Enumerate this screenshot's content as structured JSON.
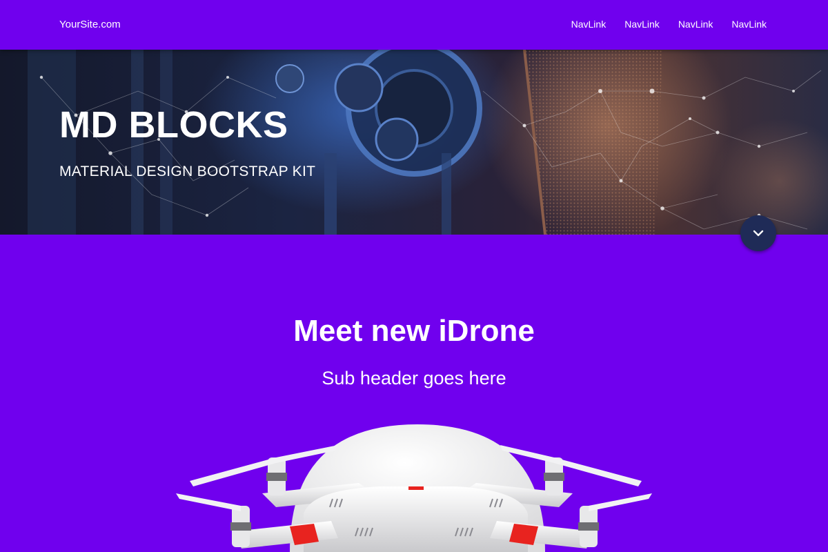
{
  "nav": {
    "brand": "YourSite.com",
    "links": [
      "NavLink",
      "NavLink",
      "NavLink",
      "NavLink"
    ]
  },
  "hero": {
    "title": "MD BLOCKS",
    "subtitle": "MATERIAL DESIGN BOOTSTRAP KIT",
    "scroll_icon": "chevron-down-icon"
  },
  "product": {
    "title": "Meet new iDrone",
    "subtitle": "Sub header goes here",
    "image_icon": "drone-image"
  },
  "colors": {
    "primary": "#7000ee",
    "scroll_button": "#1f2b57",
    "text": "#ffffff",
    "drone_accent": "#e8231f"
  }
}
